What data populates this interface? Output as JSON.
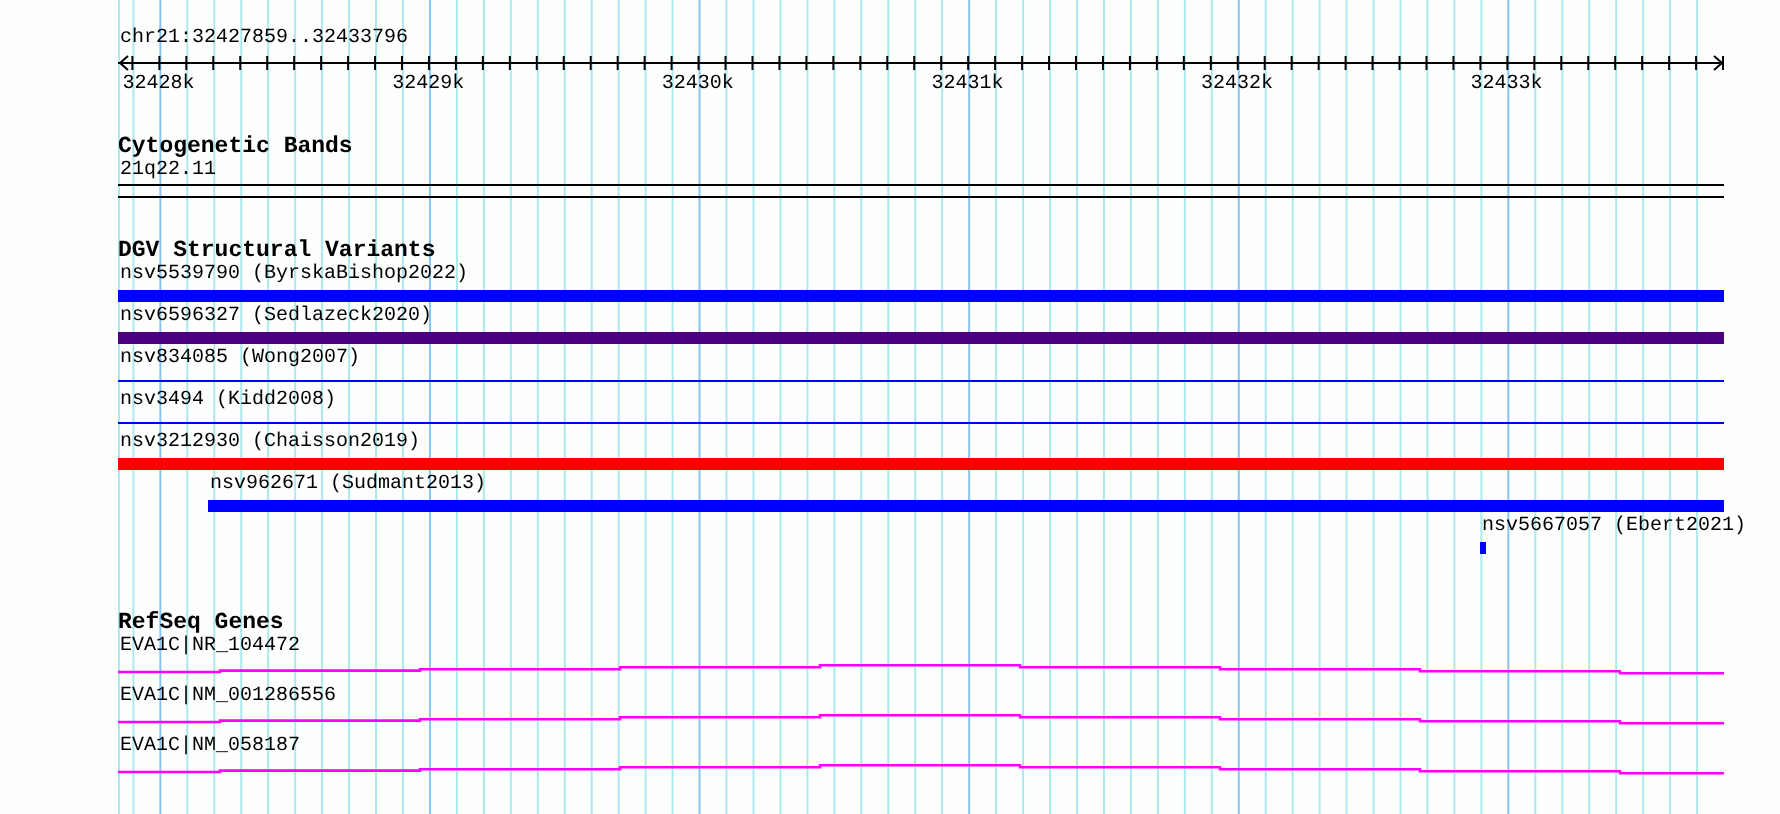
{
  "ruler": {
    "title": "chr21:32427859..32433796",
    "ticks": [
      "32428k",
      "32429k",
      "32430k",
      "32431k",
      "32432k",
      "32433k"
    ]
  },
  "cytogenetic_bands": {
    "title": "Cytogenetic Bands",
    "band": "21q22.11"
  },
  "dgv_structural_variants": {
    "title": "DGV Structural Variants",
    "variants": [
      {
        "label": "nsv5539790 (ByrskaBishop2022)",
        "color": "#0000ff",
        "kind": "thick"
      },
      {
        "label": "nsv6596327 (Sedlazeck2020)",
        "color": "#4b0082",
        "kind": "thick"
      },
      {
        "label": "nsv834085 (Wong2007)",
        "color": "#0000ff",
        "kind": "thin"
      },
      {
        "label": "nsv3494 (Kidd2008)",
        "color": "#0000ff",
        "kind": "thin"
      },
      {
        "label": "nsv3212930 (Chaisson2019)",
        "color": "#ff0000",
        "kind": "thick"
      },
      {
        "label": "nsv962671 (Sudmant2013)",
        "color": "#0000ff",
        "kind": "thick"
      },
      {
        "label": "nsv5667057 (Ebert2021)",
        "color": "#0000ff",
        "kind": "tick"
      }
    ]
  },
  "refseq_genes": {
    "title": "RefSeq Genes",
    "genes": [
      {
        "label": "EVA1C|NR_104472"
      },
      {
        "label": "EVA1C|NM_001286556"
      },
      {
        "label": "EVA1C|NM_058187"
      }
    ]
  }
}
